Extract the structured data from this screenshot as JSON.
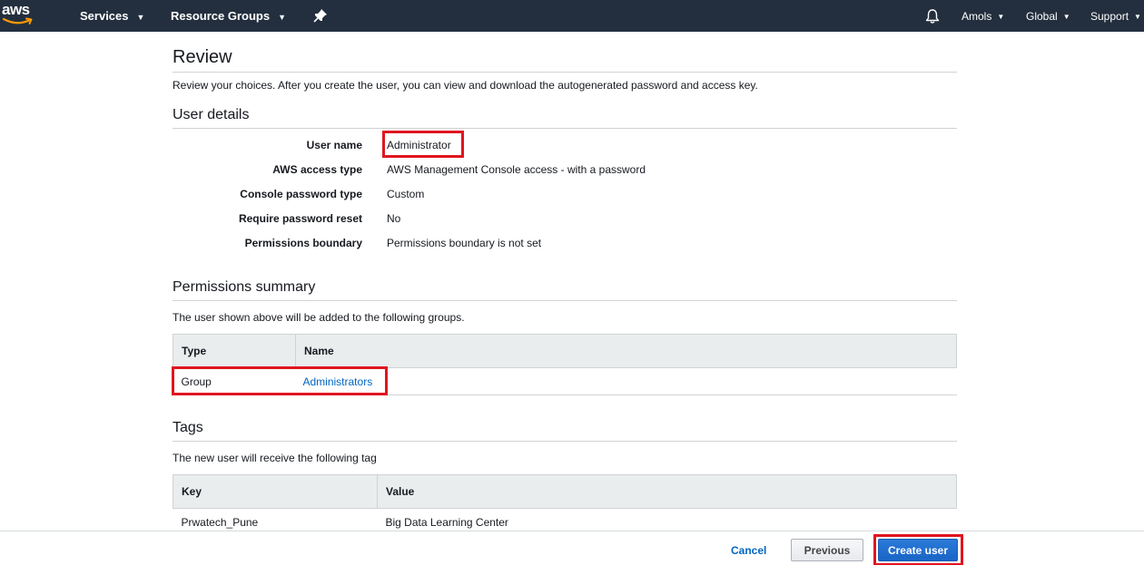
{
  "nav": {
    "logo": "aws",
    "services": "Services",
    "resource_groups": "Resource Groups",
    "user": "Amols",
    "region": "Global",
    "support": "Support",
    "icons": [
      "aws-logo",
      "pin-icon",
      "bell-icon",
      "caret-down-icon"
    ]
  },
  "review": {
    "title": "Review",
    "description": "Review your choices. After you create the user, you can view and download the autogenerated password and access key."
  },
  "user_details": {
    "heading": "User details",
    "rows": [
      {
        "label": "User name",
        "value": "Administrator"
      },
      {
        "label": "AWS access type",
        "value": "AWS Management Console access - with a password"
      },
      {
        "label": "Console password type",
        "value": "Custom"
      },
      {
        "label": "Require password reset",
        "value": "No"
      },
      {
        "label": "Permissions boundary",
        "value": "Permissions boundary is not set"
      }
    ]
  },
  "permissions": {
    "heading": "Permissions summary",
    "description": "The user shown above will be added to the following groups.",
    "columns": [
      "Type",
      "Name"
    ],
    "rows": [
      {
        "type": "Group",
        "name": "Administrators"
      }
    ]
  },
  "tags": {
    "heading": "Tags",
    "description": "The new user will receive the following tag",
    "columns": [
      "Key",
      "Value"
    ],
    "rows": [
      {
        "key": "Prwatech_Pune",
        "value": "Big Data Learning Center"
      }
    ]
  },
  "footer": {
    "cancel": "Cancel",
    "previous": "Previous",
    "create": "Create user"
  },
  "colors": {
    "topbar": "#232f3e",
    "accent_orange": "#ff9900",
    "link": "#0066c0",
    "primary_button": "#1a65c6",
    "highlight": "#e0151f"
  }
}
